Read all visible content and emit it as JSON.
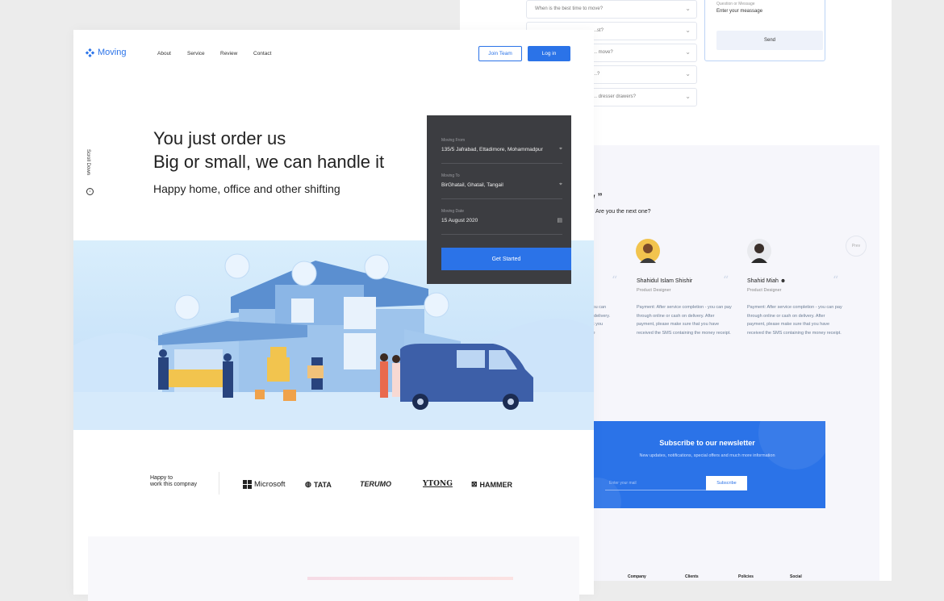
{
  "back": {
    "faq_questions": [
      "When is the best time to move?",
      "...st?",
      "... move?",
      "...?",
      "... dresser drawers?"
    ],
    "message": {
      "label": "Question or Message",
      "value": "Enter your meassage",
      "send_label": "Send"
    },
    "reviews": {
      "title": "iew ”",
      "subtitle": "Are you the next one?",
      "nav_label": "Prev",
      "partial_text": "tion - you can pay on delivery. ure that you ning the",
      "items": [
        {
          "name": "Shahidul Islam Shishir",
          "role": "Product Designer",
          "text": "Payment: After service completion - you can pay through online or cash on delivery. After payment, please make sure that you have received the SMS containing the money receipt."
        },
        {
          "name": "Shahid Miah",
          "role": "Product Designer",
          "text": "Payment: After service completion - you can pay through online or cash on delivery. After payment, please make sure that you have received the SMS containing the money receipt."
        }
      ]
    },
    "newsletter": {
      "title": "Subscribe to our newsletter",
      "subtitle": "New updates, notifications, special offers and much more information",
      "placeholder": "Enter your mail",
      "button": "Subscribe"
    },
    "footer_cols": [
      "Company",
      "Clients",
      "Policies",
      "Social"
    ]
  },
  "front": {
    "logo": "Moving",
    "nav": [
      "About",
      "Service",
      "Review",
      "Contact"
    ],
    "join_label": "Join Team",
    "login_label": "Log in",
    "scroll_label": "Scroll Down",
    "hero": {
      "line1": "You just order us",
      "line2": "Big or small, we can handle it",
      "sub": "Happy home, office and other shifting"
    },
    "form": {
      "from_label": "Moving From",
      "from_value": "135/5 Jafrabad, Ettadimore, Mohammadpur",
      "to_label": "Moving To",
      "to_value": "BirGhatail, Ghatail, Tangail",
      "date_label": "Moving Date",
      "date_value": "15 August 2020",
      "button": "Get Started"
    },
    "partners": {
      "caption_line1": "Happy to",
      "caption_line2": "work this compnay",
      "logos": [
        "Microsoft",
        "TATA",
        "TERUMO",
        "YTONG",
        "HAMMER"
      ]
    }
  },
  "colors": {
    "accent": "#2b73e8",
    "card": "#3c3d41",
    "sky": "#cfe8fb"
  }
}
